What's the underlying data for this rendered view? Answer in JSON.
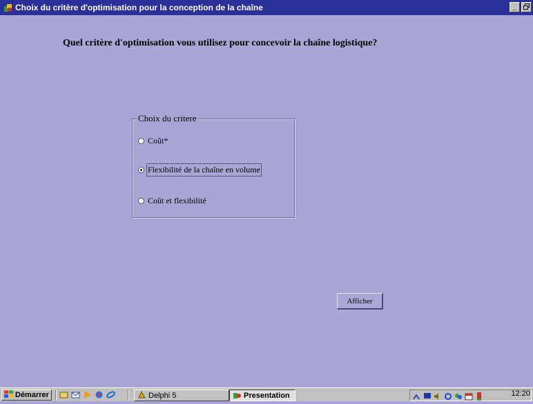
{
  "window": {
    "title": "Choix du critère d'optimisation pour la conception de la chaîne",
    "controls": {
      "minimize": "_",
      "restore": "🗗"
    }
  },
  "main": {
    "question": "Quel critère d'optimisation vous utilisez pour concevoir la chaîne logistique?",
    "group": {
      "legend": "Choix du critere",
      "options": [
        {
          "label": "Coût*",
          "checked": false
        },
        {
          "label": "Flexibilité de la chaîne en volume",
          "checked": true
        },
        {
          "label": "Coût et flexibilité",
          "checked": false
        }
      ]
    },
    "afficher_button": "Afficher"
  },
  "taskbar": {
    "start_label": "Démarrer",
    "tasks": [
      {
        "label": "Delphi 5",
        "active": false
      },
      {
        "label": "Presentation",
        "active": true
      }
    ],
    "clock": "12:20"
  },
  "colors": {
    "background": "#a9a5d6",
    "titlebar": "#2b2f9a",
    "taskbar": "#c0c0c0"
  }
}
